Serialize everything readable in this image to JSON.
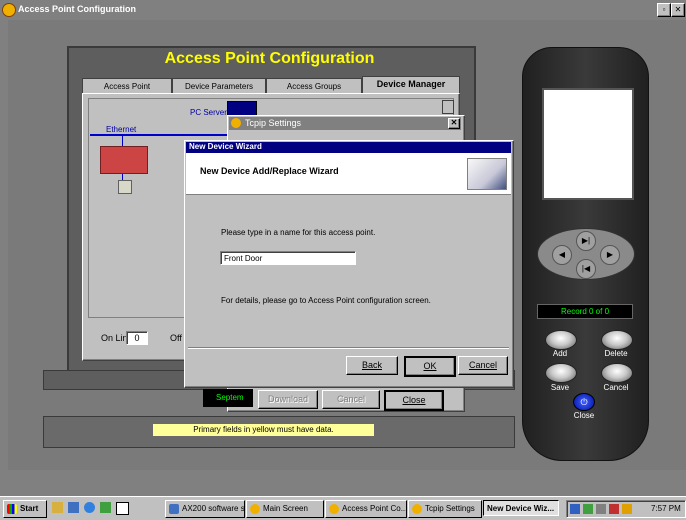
{
  "window": {
    "title": "Access Point Configuration"
  },
  "app": {
    "heading": "Access Point Configuration"
  },
  "tabs": [
    {
      "label": "Access Point"
    },
    {
      "label": "Device Parameters"
    },
    {
      "label": "Access Groups"
    },
    {
      "label": "Device Manager"
    }
  ],
  "diagram": {
    "pc_server_label": "PC Server",
    "ethernet_label": "Ethernet"
  },
  "status_row": {
    "online_label": "On Line",
    "online_value": "0",
    "offline_label": "Off L"
  },
  "tcpip": {
    "title": "Tcpip Settings",
    "download_label": "Download",
    "cancel_label": "Cancel",
    "close_label": "Close"
  },
  "left_date_fragment": "Septem",
  "status_hint": "Primary fields in yellow must have data.",
  "wizard": {
    "title": "New Device Wizard",
    "header": "New Device Add/Replace Wizard",
    "prompt": "Please type in a name for this access point.",
    "name_value": "Front Door",
    "details": "For details, please go to Access Point configuration screen.",
    "back_label": "Back",
    "ok_label": "OK",
    "cancel_label": "Cancel"
  },
  "panel": {
    "record_text": "Record 0 of 0",
    "add_label": "Add",
    "delete_label": "Delete",
    "save_label": "Save",
    "cancel_label": "Cancel",
    "close_label": "Close"
  },
  "taskbar": {
    "start_label": "Start",
    "items": [
      {
        "label": "AX200 software se..."
      },
      {
        "label": "Main Screen"
      },
      {
        "label": "Access Point Co..."
      },
      {
        "label": "Tcpip Settings"
      },
      {
        "label": "New Device Wiz..."
      }
    ],
    "clock": "7:57 PM"
  },
  "colors": {
    "titlebar": "#000080",
    "heading": "#ffff00",
    "hint_bg": "#ffff99",
    "record_green": "#00ff00"
  }
}
